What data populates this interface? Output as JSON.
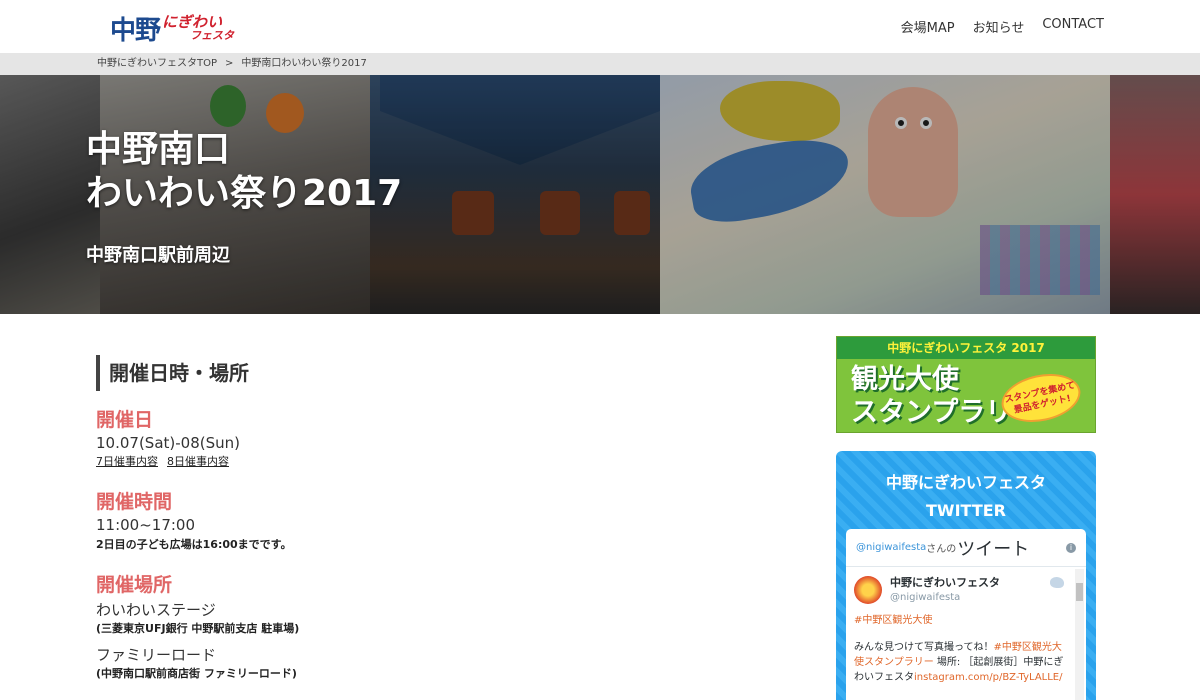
{
  "header": {
    "logo_main": "中野",
    "logo_sub_a": "にぎわい",
    "logo_sub_b": "フェスタ",
    "nav": [
      "会場MAP",
      "お知らせ",
      "CONTACT"
    ]
  },
  "breadcrumb": {
    "home": "中野にぎわいフェスタTOP",
    "separator": ">",
    "current": "中野南口わいわい祭り2017"
  },
  "hero": {
    "title_line1": "中野南口",
    "title_line2": "わいわい祭り2017",
    "subtitle": "中野南口駅前周辺"
  },
  "main": {
    "section_title": "開催日時・場所",
    "date_label": "開催日",
    "date_value": "10.07(Sat)-08(Sun)",
    "date_links": [
      "7日催事内容",
      "8日催事内容"
    ],
    "time_label": "開催時間",
    "time_value": "11:00~17:00",
    "time_note": "2日目の子ども広場は16:00までです。",
    "venue_label": "開催場所",
    "venues": [
      {
        "name": "わいわいステージ",
        "note": "(三菱東京UFJ銀行 中野駅前支店 駐車場)"
      },
      {
        "name": "ファミリーロード",
        "note": "(中野南口駅前商店街 ファミリーロード)"
      }
    ]
  },
  "sidebar": {
    "banner_top": "中野にぎわいフェスタ 2017",
    "banner_line1": "観光大使",
    "banner_line2": "スタンプラリー",
    "banner_badge": "スタンプを集めて景品をゲット!",
    "twitter_title_line1": "中野にぎわいフェスタ",
    "twitter_title_line2": "TWITTER",
    "tw_handle": "@nigiwaifesta",
    "tw_handle_suffix": "さんの",
    "tw_label": "ツイート",
    "tweet": {
      "name": "中野にぎわいフェスタ",
      "handle": "@nigiwaifesta",
      "tag": "#中野区観光大使",
      "text_before": "みんな見つけて写真撮ってね！",
      "text_tag": "#中野区観光大使スタンプラリー",
      "text_after": " 場所: ［起創展街］中野にぎわいフェスタ",
      "link": "instagram.com/p/BZ-TyLALLE/"
    }
  },
  "colors": {
    "accent_label": "#e06666",
    "twitter_blue": "#2aa2ec",
    "logo_blue": "#1d4a8f",
    "logo_red": "#d0212e"
  }
}
